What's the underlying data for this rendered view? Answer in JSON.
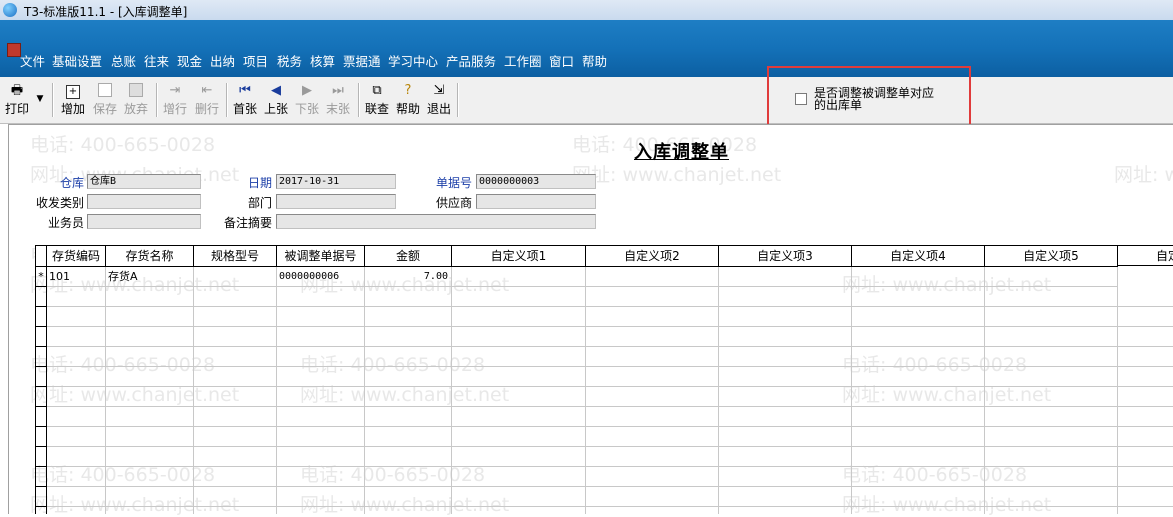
{
  "window": {
    "title": "T3-标准版11.1 - [入库调整单]"
  },
  "menu": [
    "文件",
    "基础设置",
    "总账",
    "往来",
    "现金",
    "出纳",
    "项目",
    "税务",
    "核算",
    "票据通",
    "学习中心",
    "产品服务",
    "工作圈",
    "窗口",
    "帮助"
  ],
  "toolbar": {
    "print": "打印",
    "add": "增加",
    "save": "保存",
    "discard": "放弃",
    "insert_row": "增行",
    "delete_row": "删行",
    "first": "首张",
    "prev": "上张",
    "next": "下张",
    "last": "末张",
    "link_query": "联查",
    "help": "帮助",
    "exit": "退出"
  },
  "option": {
    "label": "是否调整被调整单对应的出库单",
    "checked": false
  },
  "form": {
    "title": "入库调整单",
    "warehouse_label": "仓库",
    "warehouse_value": "仓库B",
    "date_label": "日期",
    "date_value": "2017-10-31",
    "docno_label": "单据号",
    "docno_value": "0000000003",
    "type_label": "收发类别",
    "type_value": "",
    "dept_label": "部门",
    "dept_value": "",
    "supplier_label": "供应商",
    "supplier_value": "",
    "clerk_label": "业务员",
    "clerk_value": "",
    "remark_label": "备注摘要",
    "remark_value": ""
  },
  "grid": {
    "headers": [
      "存货编码",
      "存货名称",
      "规格型号",
      "被调整单据号",
      "金额",
      "自定义项1",
      "自定义项2",
      "自定义项3",
      "自定义项4",
      "自定义项5",
      "自定"
    ],
    "rows": [
      {
        "marker": "*",
        "code": "101",
        "name": "存货A",
        "spec": "",
        "ref": "0000000006",
        "amount": "7.00",
        "c1": "",
        "c2": "",
        "c3": "",
        "c4": "",
        "c5": ""
      }
    ]
  },
  "watermark": {
    "phone": "电话: 400-665-0028",
    "site": "网址: www.chanjet.net"
  },
  "colors": {
    "menu_band": "#1471b8",
    "highlight_border": "#e03b3b",
    "label_blue": "#1c3fa8"
  }
}
